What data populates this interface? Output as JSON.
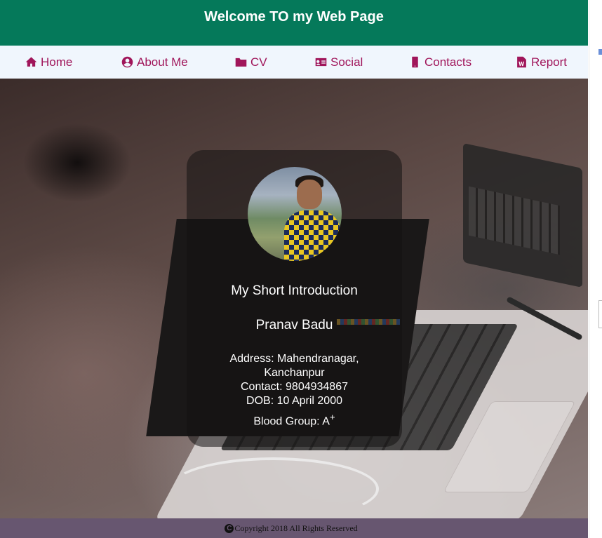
{
  "header": {
    "title": "Welcome TO my Web Page"
  },
  "nav": {
    "items": [
      {
        "label": "Home",
        "icon": "home-icon"
      },
      {
        "label": "About Me",
        "icon": "user-circle-icon"
      },
      {
        "label": "CV",
        "icon": "folder-icon"
      },
      {
        "label": "Social",
        "icon": "id-card-icon"
      },
      {
        "label": "Contacts",
        "icon": "mobile-phone-icon"
      },
      {
        "label": "Report",
        "icon": "word-document-icon"
      }
    ],
    "color": "#a0155a"
  },
  "card": {
    "heading": "My Short Introduction",
    "name": "Pranav Badu",
    "address_line1": "Address: Mahendranagar,",
    "address_line2": "Kanchanpur",
    "contact": "Contact: 9804934867",
    "dob": "DOB: 10 April 2000",
    "blood_group_label": "Blood Group: A",
    "blood_group_sign": "+"
  },
  "footer": {
    "text": "Copyright 2018 All Rights Reserved",
    "icon": "copyright-icon"
  },
  "colors": {
    "header_bg": "#05795a",
    "nav_bg": "#f0f6fd",
    "footer_bg": "#675670"
  }
}
